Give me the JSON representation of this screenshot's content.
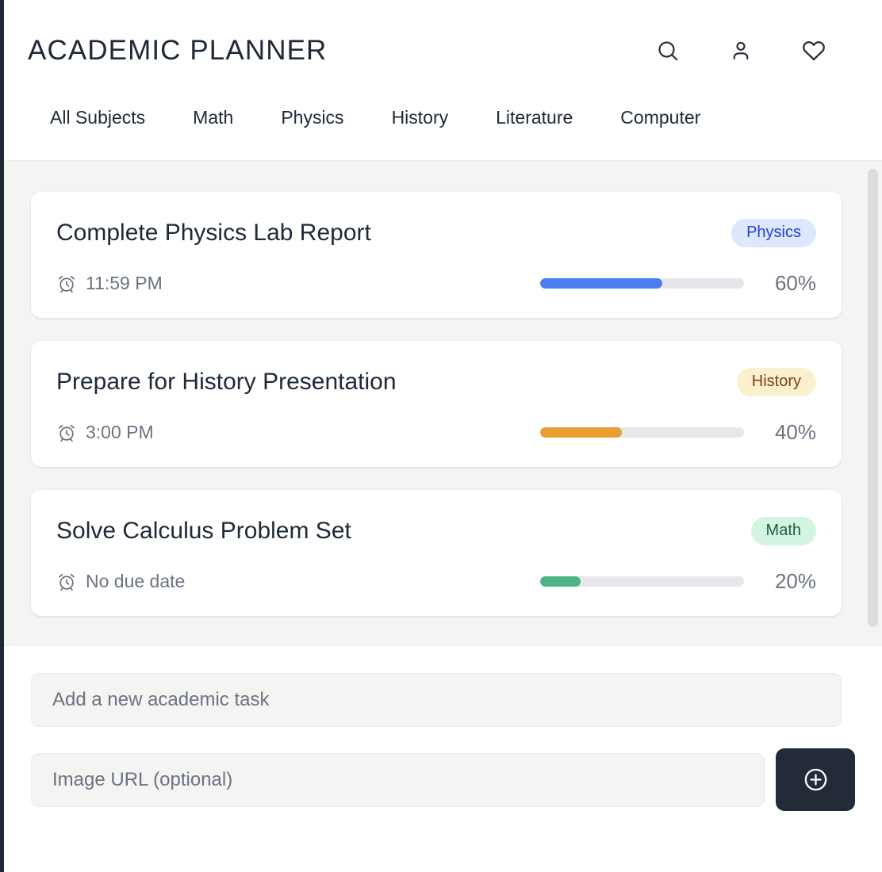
{
  "header": {
    "title": "ACADEMIC PLANNER",
    "actions": [
      {
        "name": "search-icon",
        "label": "Search"
      },
      {
        "name": "account-icon",
        "label": "Account"
      },
      {
        "name": "favorites-heart-icon",
        "label": "Favorites"
      }
    ]
  },
  "tabs": [
    {
      "label": "All Subjects"
    },
    {
      "label": "Math"
    },
    {
      "label": "Physics"
    },
    {
      "label": "History"
    },
    {
      "label": "Literature"
    },
    {
      "label": "Computer"
    }
  ],
  "tasks": [
    {
      "title": "Complete Physics Lab Report",
      "due": "11:59 PM",
      "subject": "Physics",
      "badge_bg": "#dde7fd",
      "badge_fg": "#2540d6",
      "progress": 60,
      "progress_label": "60%",
      "progress_color": "#4a7ef0"
    },
    {
      "title": "Prepare for History Presentation",
      "due": "3:00 PM",
      "subject": "History",
      "badge_bg": "#fbf0ce",
      "badge_fg": "#7a3d14",
      "progress": 40,
      "progress_label": "40%",
      "progress_color": "#e8a031"
    },
    {
      "title": "Solve Calculus Problem Set",
      "due": "No due date",
      "subject": "Math",
      "badge_bg": "#d3f4e0",
      "badge_fg": "#1d6040",
      "progress": 20,
      "progress_label": "20%",
      "progress_color": "#4cb483"
    }
  ],
  "form": {
    "task_placeholder": "Add a new academic task",
    "task_value": "",
    "image_placeholder": "Image URL (optional)",
    "image_value": "",
    "add_button_label": "Add task"
  },
  "colors": {
    "page_bg": "#ffffff",
    "list_bg": "#f4f4f2",
    "text_primary": "#1f2937",
    "text_muted": "#6b7280",
    "accent_dark": "#232b38",
    "track": "#e5e7eb"
  }
}
